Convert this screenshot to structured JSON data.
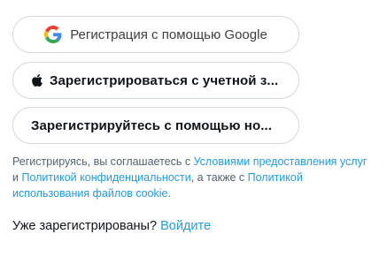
{
  "buttons": {
    "google": "Регистрация с помощью Google",
    "apple": "Зарегистрироваться с учетной з...",
    "phone": "Зарегистрируйтесь с помощью но..."
  },
  "terms": {
    "prefix": "Регистрируясь, вы соглашаетесь с ",
    "tos_link": "Условиями предоставления услуг",
    "and": " и ",
    "privacy_link": "Политикой конфиденциальности",
    "also": ", а также с ",
    "cookie_link": "Политикой использования файлов cookie",
    "suffix": "."
  },
  "login": {
    "question": "Уже зарегистрированы?",
    "link": "Войдите"
  },
  "icons": {
    "google": "google-g-icon",
    "apple": "apple-icon"
  },
  "colors": {
    "link": "#1d9bf0",
    "muted": "#536471",
    "border": "#cfd9de"
  }
}
